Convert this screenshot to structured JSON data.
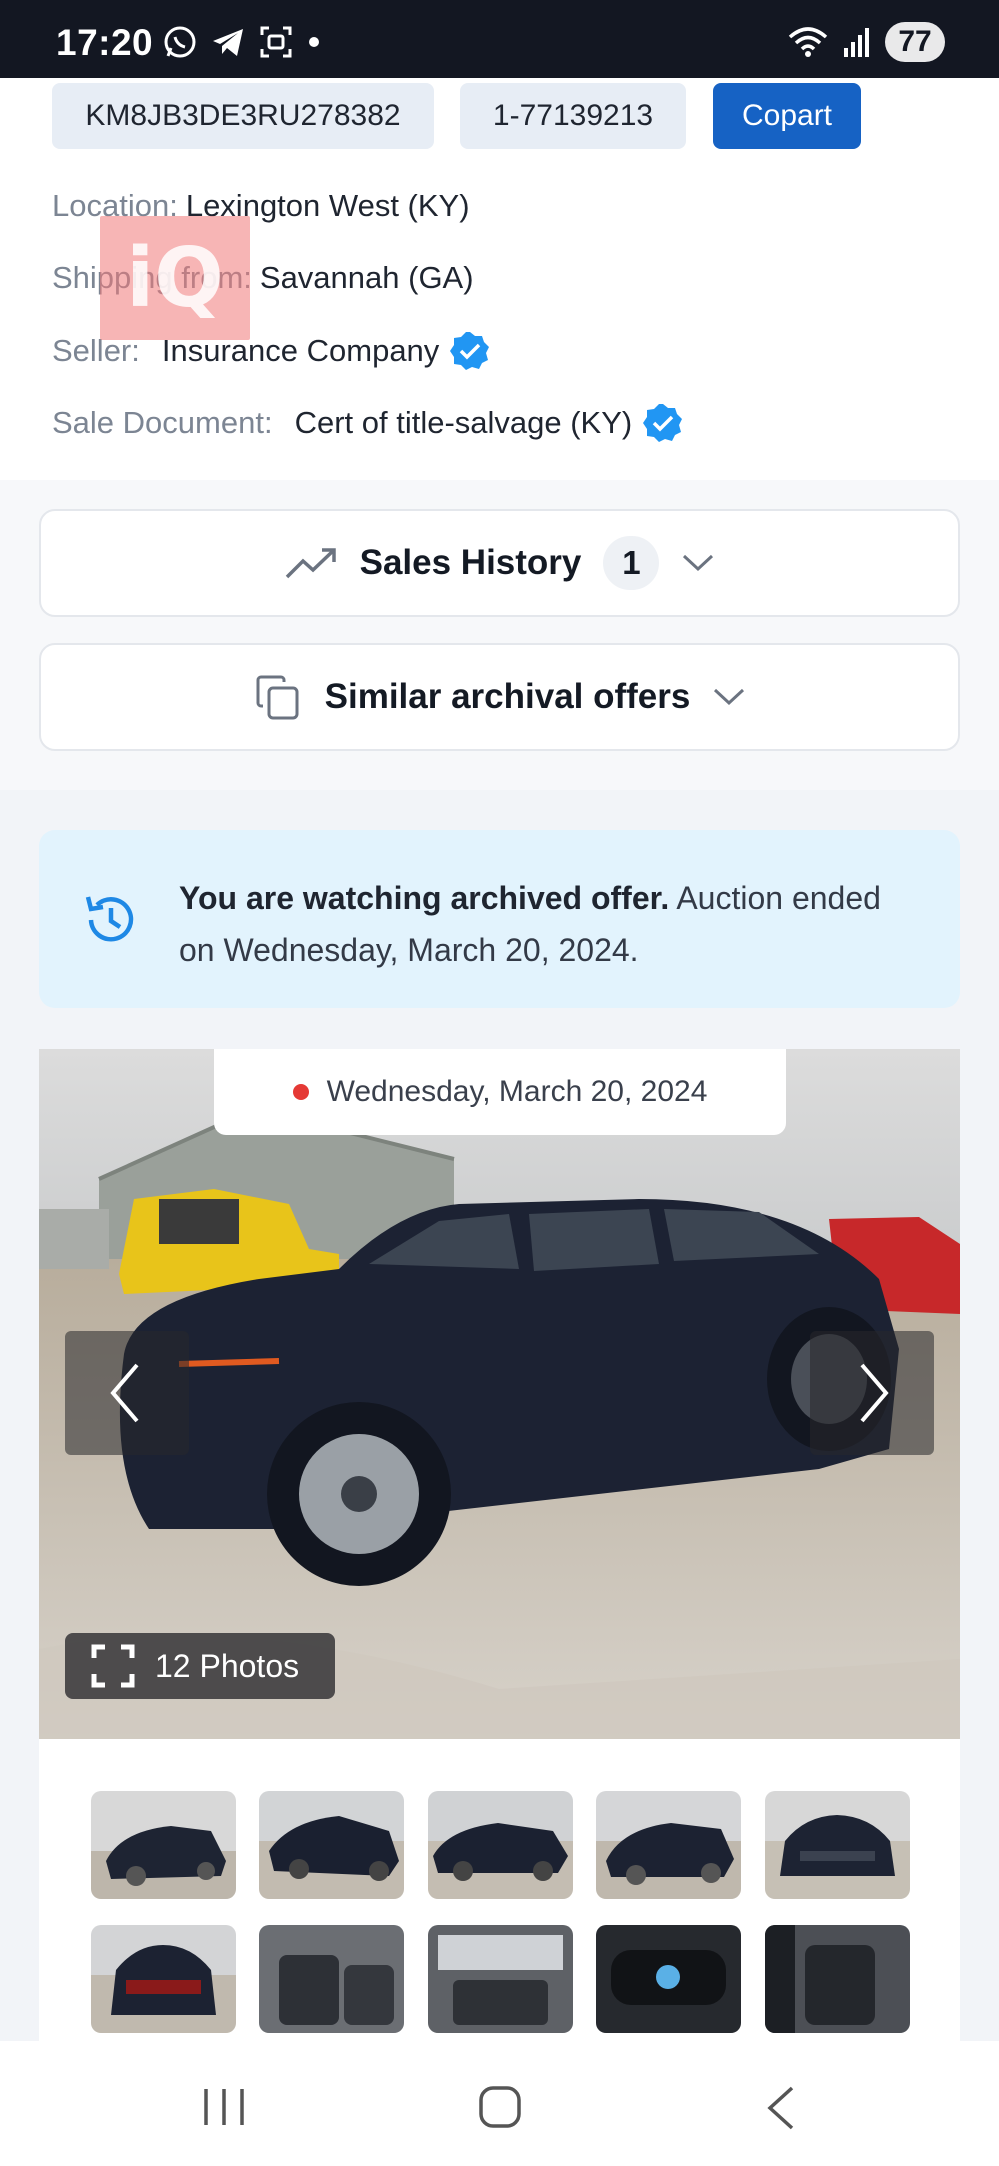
{
  "status_bar": {
    "time": "17:20",
    "battery": "77"
  },
  "vehicle": {
    "vin": "KM8JB3DE3RU278382",
    "lot": "1-77139213",
    "auction_button": "Copart"
  },
  "details": {
    "location_label": "Location:",
    "location_value": "Lexington West (KY)",
    "shipping_label": "Shipping from:",
    "shipping_value": "Savannah (GA)",
    "seller_label": "Seller:",
    "seller_value": "Insurance Company",
    "doc_label": "Sale Document:",
    "doc_value": "Cert of title-salvage (KY)"
  },
  "watermark": "iQ",
  "sales_history": {
    "label": "Sales History",
    "count": "1"
  },
  "similar_offers": {
    "label": "Similar archival offers"
  },
  "archived": {
    "bold": "You are watching archived offer.",
    "text": " Auction ended on Wednesday, March 20, 2024."
  },
  "gallery": {
    "date": "Wednesday, March 20, 2024",
    "photos_label": "12 Photos"
  },
  "colors": {
    "accent": "#1662c4",
    "status_bar": "#131722",
    "archived_bg": "#e2f3fd",
    "verified": "#2196f3"
  },
  "icons": [
    "whatsapp-icon",
    "telegram-icon",
    "screenshot-icon",
    "wifi-icon",
    "signal-icon",
    "verified-icon",
    "trend-icon",
    "copy-icon",
    "chevron-down-icon",
    "history-icon",
    "expand-icon",
    "chevron-left-icon",
    "chevron-right-icon"
  ]
}
